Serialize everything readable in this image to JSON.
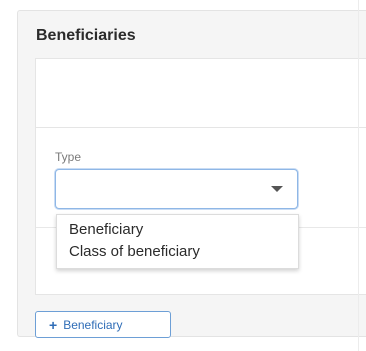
{
  "section": {
    "title": "Beneficiaries"
  },
  "form": {
    "type_label": "Type",
    "type_value": "",
    "options": [
      "Beneficiary",
      "Class of beneficiary"
    ]
  },
  "actions": {
    "add_icon": "+",
    "add_label": "Beneficiary"
  }
}
